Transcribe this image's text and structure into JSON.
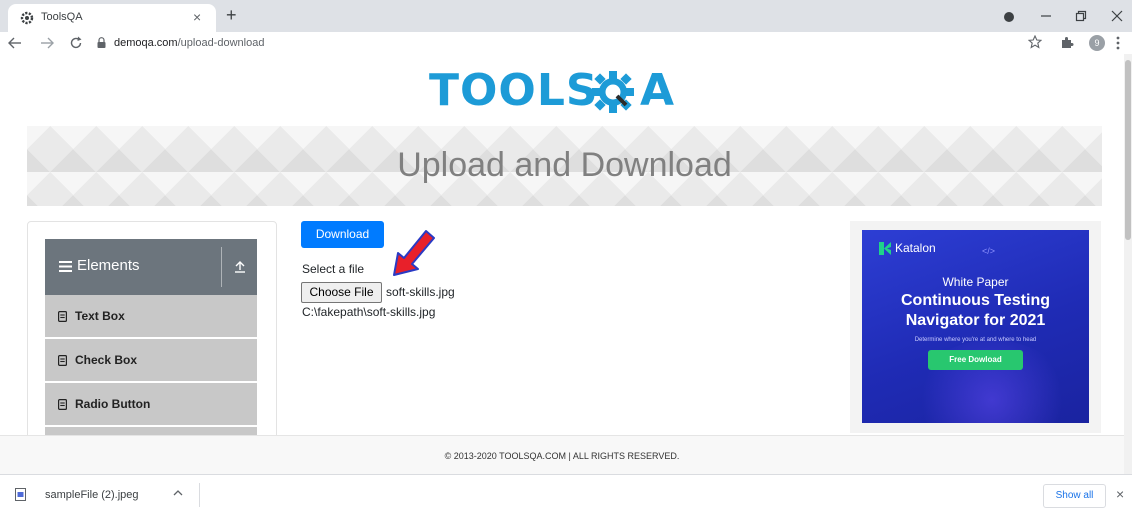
{
  "browser": {
    "tab_title": "ToolsQA",
    "tab_close": "×",
    "new_tab": "+",
    "url_host": "demoqa.com",
    "url_path": "/upload-download",
    "profile_initial": "9",
    "icons": [
      "back-icon",
      "forward-icon",
      "reload-icon",
      "lock-icon",
      "star-icon",
      "extensions-icon",
      "menu-dots-icon",
      "minimize-icon",
      "maximize-icon",
      "close-icon"
    ]
  },
  "page": {
    "logo_text": "TOOLS",
    "logo_suffix": "A",
    "banner_title": "Upload and Download",
    "sidebar": {
      "group_title": "Elements",
      "items": [
        {
          "label": "Text Box"
        },
        {
          "label": "Check Box"
        },
        {
          "label": "Radio Button"
        }
      ]
    },
    "main": {
      "download_label": "Download",
      "select_label": "Select a file",
      "choose_file_label": "Choose File",
      "selected_file": "soft-skills.jpg",
      "uploaded_path": "C:\\fakepath\\soft-skills.jpg"
    },
    "ad": {
      "brand": "Katalon",
      "code_glyph": "</>",
      "kicker": "White Paper",
      "title_line1": "Continuous Testing",
      "title_line2": "Navigator for 2021",
      "subtitle": "Determine where you're at and where to head",
      "cta": "Free Dowload"
    },
    "footer_text": "© 2013-2020 TOOLSQA.COM | ALL RIGHTS RESERVED."
  },
  "download_shelf": {
    "file_name": "sampleFile (2).jpeg",
    "show_all": "Show all",
    "close": "×"
  },
  "colors": {
    "brand_blue": "#1d9bd7",
    "primary_button": "#007bff",
    "sidebar_header": "#6c757d",
    "menu_item_bg": "#c8c8c8",
    "annotation_arrow": "#e8202a",
    "ad_background": "#2d3ed4",
    "ad_cta": "#28c76f"
  }
}
